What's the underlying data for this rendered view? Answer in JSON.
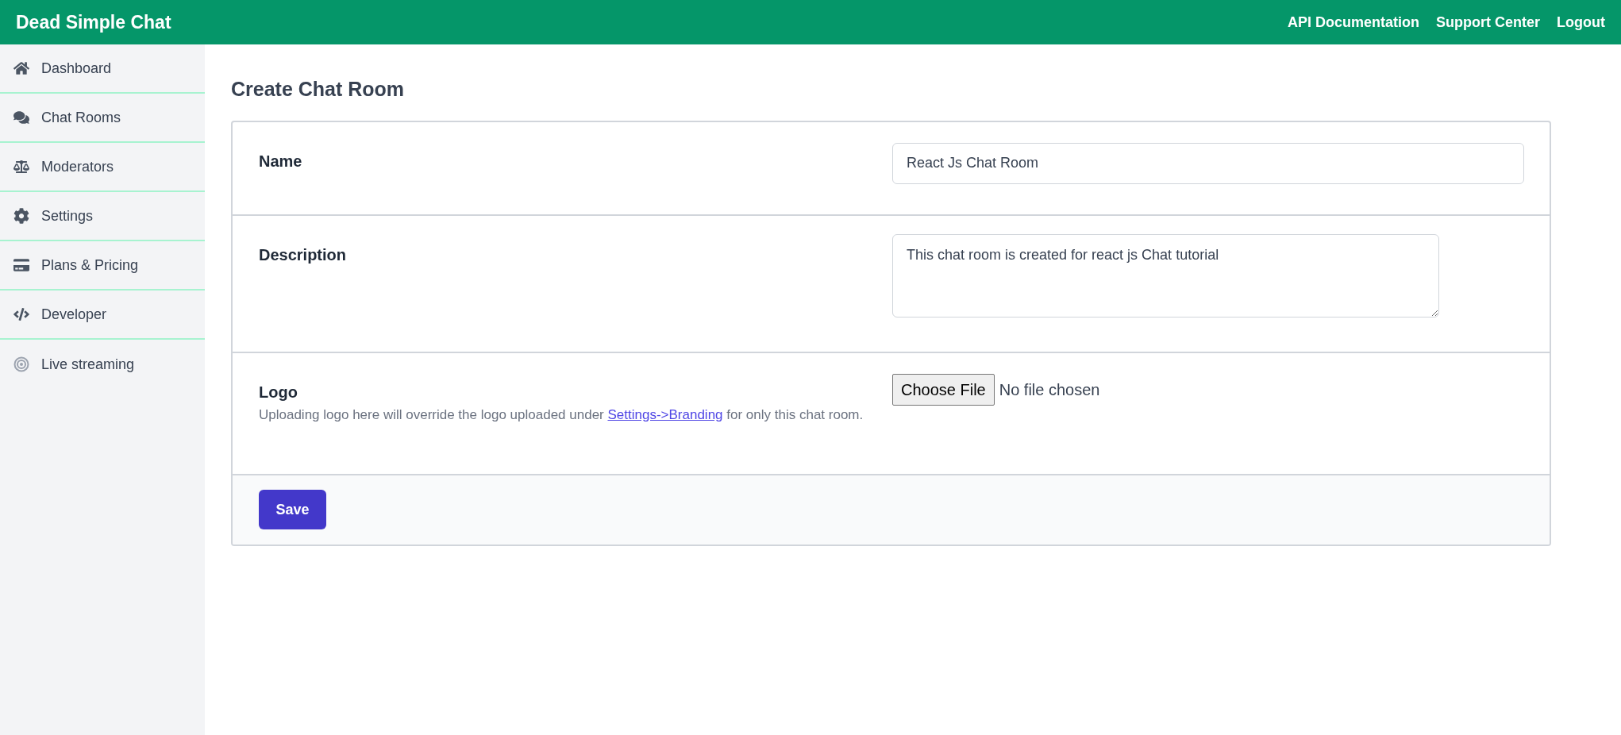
{
  "header": {
    "brand": "Dead Simple Chat",
    "links": [
      "API Documentation",
      "Support Center",
      "Logout"
    ]
  },
  "sidebar": {
    "items": [
      {
        "label": "Dashboard",
        "kind": "home"
      },
      {
        "label": "Chat Rooms",
        "kind": "chat"
      },
      {
        "label": "Moderators",
        "kind": "scale"
      },
      {
        "label": "Settings",
        "kind": "gear"
      },
      {
        "label": "Plans & Pricing",
        "kind": "card"
      },
      {
        "label": "Developer",
        "kind": "code"
      },
      {
        "label": "Live streaming",
        "kind": "stream"
      }
    ]
  },
  "page_title": "Create Chat Room",
  "form": {
    "name": {
      "label": "Name",
      "value": "React Js Chat Room"
    },
    "description": {
      "label": "Description",
      "value": "This chat room is created for react js Chat tutorial"
    },
    "logo": {
      "label": "Logo",
      "hint_before": "Uploading logo here will override the logo uploaded under",
      "hint_link": "Settings->Branding",
      "hint_after": "for only this chat room.",
      "file_button": "Choose File",
      "file_status": "No file chosen"
    },
    "save_button": "Save"
  }
}
